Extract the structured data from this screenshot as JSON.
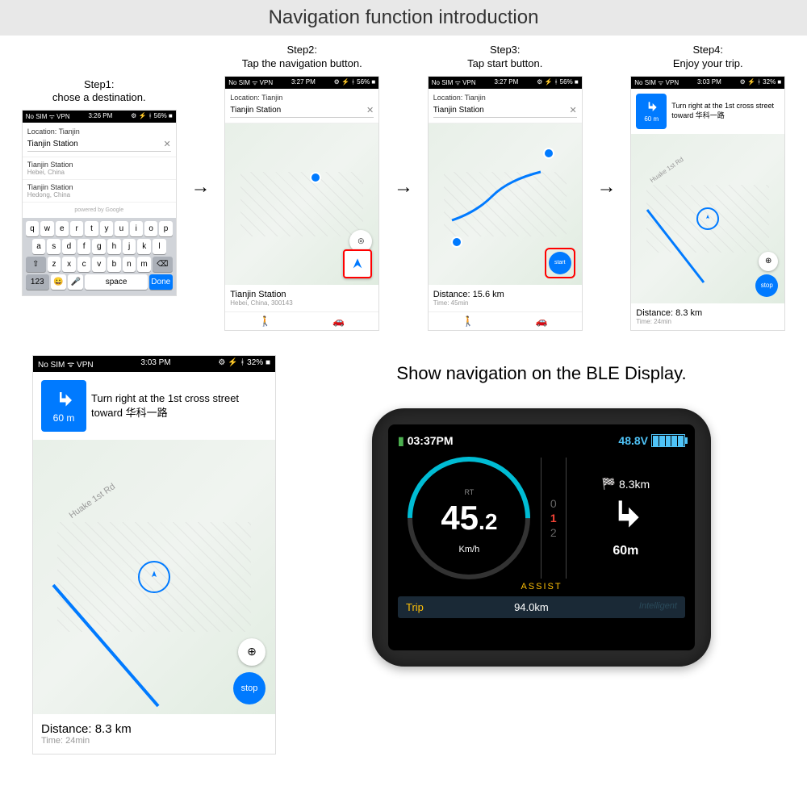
{
  "title": "Navigation function introduction",
  "steps": [
    {
      "num": "Step1:",
      "desc": "chose a destination."
    },
    {
      "num": "Step2:",
      "desc": "Tap the navigation button."
    },
    {
      "num": "Step3:",
      "desc": "Tap start button."
    },
    {
      "num": "Step4:",
      "desc": "Enjoy your trip."
    }
  ],
  "status": {
    "carrier": "No SIM ᯤ VPN",
    "time1": "3:26 PM",
    "time2": "3:27 PM",
    "time3": "3:27 PM",
    "time4": "3:03 PM",
    "battery1": "⚙ ⚡ ᚼ 56% ■",
    "battery4": "⚙ ⚡ ᚼ 32% ■"
  },
  "search": {
    "location_label": "Location:",
    "location_value": "Tianjin",
    "query": "Tianjin Station",
    "suggestions": [
      {
        "main": "Tianjin Station",
        "sub": "Hebei, China"
      },
      {
        "main": "Tianjin Station",
        "sub": "Hedong, China"
      }
    ],
    "powered": "powered by Google"
  },
  "keyboard": {
    "row1": [
      "q",
      "w",
      "e",
      "r",
      "t",
      "y",
      "u",
      "i",
      "o",
      "p"
    ],
    "row2": [
      "a",
      "s",
      "d",
      "f",
      "g",
      "h",
      "j",
      "k",
      "l"
    ],
    "row3_start": "⇧",
    "row3": [
      "z",
      "x",
      "c",
      "v",
      "b",
      "n",
      "m"
    ],
    "row3_end": "⌫",
    "row4": {
      "num": "123",
      "emoji": "😀",
      "mic": "🎤",
      "space": "space",
      "done": "Done"
    }
  },
  "dest2": {
    "main": "Tianjin Station",
    "sub": "Hebei, China, 300143"
  },
  "dest3": {
    "distance": "Distance: 15.6 km",
    "time": "Time: 45min",
    "start": "start"
  },
  "dest4": {
    "distance": "Distance: 8.3 km",
    "time": "Time: 24min",
    "stop": "stop"
  },
  "turn": {
    "instruction": "Turn right at the 1st cross street toward 华科一路",
    "dist": "60 m"
  },
  "road": "Huake 1st Rd",
  "ble_title": "Show navigation on the BLE Display.",
  "ble": {
    "time": "03:37PM",
    "voltage": "48.8V",
    "speed_int": "45",
    "speed_dec": ".2",
    "speed_unit": "Km/h",
    "rt": "RT",
    "assist": [
      "0",
      "1",
      "2"
    ],
    "assist_label": "ASSIST",
    "nav_top_dist": "8.3km",
    "nav_bottom_dist": "60m",
    "trip_label": "Trip",
    "trip_val": "94.0km",
    "brand": "Intelligent"
  }
}
